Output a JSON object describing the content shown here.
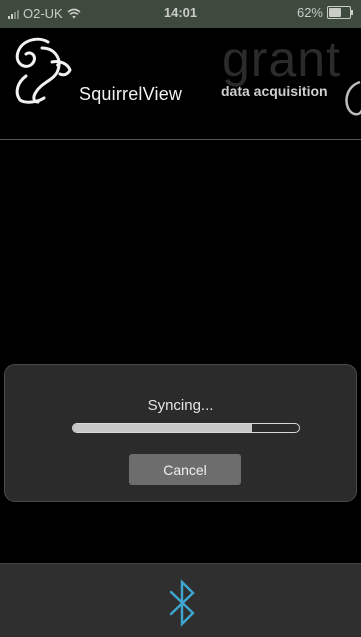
{
  "status_bar": {
    "carrier": "O2-UK",
    "time": "14:01",
    "battery_percent_label": "62%",
    "battery_level": 0.62,
    "wifi_icon": "wifi-icon",
    "signal_icon": "signal-icon"
  },
  "header": {
    "app_name": "SquirrelView",
    "brand_name": "grant",
    "brand_tagline": "data acquisition",
    "logo_icon": "squirrel-logo-icon"
  },
  "dialog": {
    "title": "Syncing...",
    "progress": 0.79,
    "cancel_label": "Cancel"
  },
  "bottom_bar": {
    "icon": "bluetooth-icon",
    "accent_color": "#3ea6d0"
  }
}
